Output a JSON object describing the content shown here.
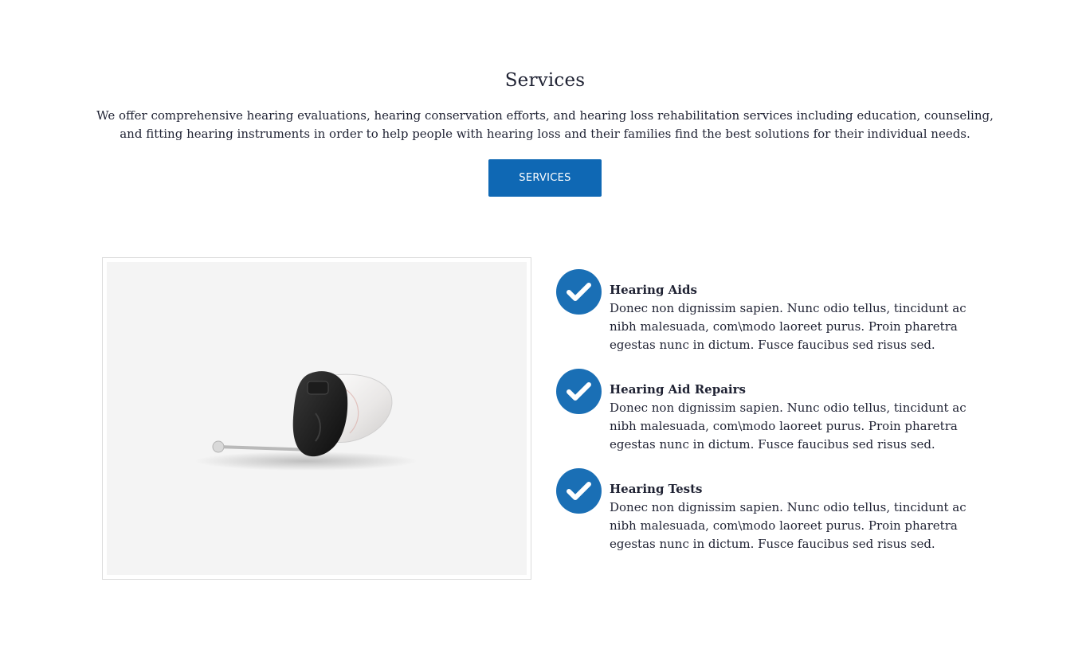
{
  "services": {
    "title": "Services",
    "intro": "We offer comprehensive hearing evaluations, hearing conservation efforts, and hearing loss rehabilitation services including education, counseling, and fitting hearing instruments in order to help people with hearing loss and their families find the best solutions for their individual needs.",
    "button_label": "SERVICES"
  },
  "colors": {
    "accent": "#1a6fb5",
    "button": "#0f68b4",
    "text": "#1f2233",
    "image_bg": "#f4f4f4"
  },
  "image": {
    "subject": "hearing-aid-device"
  },
  "features": [
    {
      "icon": "check-icon",
      "title": "Hearing Aids",
      "text": "Donec non dignissim sapien. Nunc odio tellus, tincidunt ac nibh malesuada, com\\modo laoreet purus. Proin pharetra egestas nunc in dictum. Fusce faucibus sed risus sed."
    },
    {
      "icon": "check-icon",
      "title": "Hearing Aid Repairs",
      "text": "Donec non dignissim sapien. Nunc odio tellus, tincidunt ac nibh malesuada, com\\modo laoreet purus. Proin pharetra egestas nunc in dictum. Fusce faucibus sed risus sed."
    },
    {
      "icon": "check-icon",
      "title": "Hearing Tests",
      "text": "Donec non dignissim sapien. Nunc odio tellus, tincidunt ac nibh malesuada, com\\modo laoreet purus. Proin pharetra egestas nunc in dictum. Fusce faucibus sed risus sed."
    }
  ]
}
